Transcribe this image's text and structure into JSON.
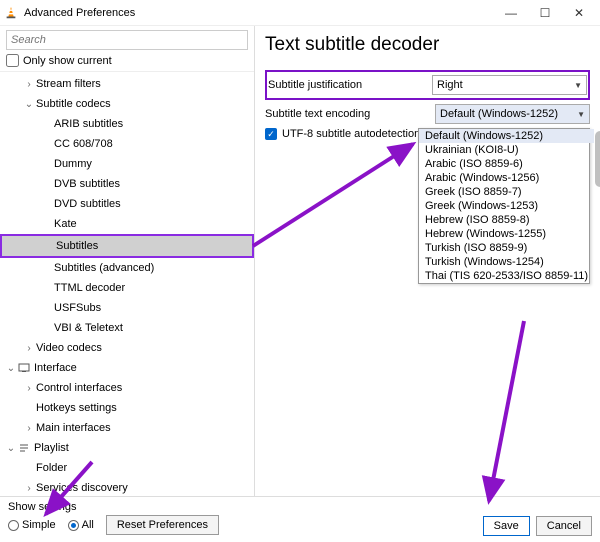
{
  "window": {
    "title": "Advanced Preferences",
    "min": "—",
    "max": "☐",
    "close": "✕"
  },
  "search": {
    "placeholder": "Search"
  },
  "only_current": "Only show current",
  "tree": {
    "stream_filters": "Stream filters",
    "subtitle_codecs": "Subtitle codecs",
    "arib": "ARIB subtitles",
    "cc": "CC 608/708",
    "dummy": "Dummy",
    "dvb": "DVB subtitles",
    "dvd": "DVD subtitles",
    "kate": "Kate",
    "subtitles": "Subtitles",
    "subtitles_adv": "Subtitles (advanced)",
    "ttml": "TTML decoder",
    "usf": "USFSubs",
    "vbi": "VBI & Teletext",
    "video_codecs": "Video codecs",
    "interface": "Interface",
    "control_if": "Control interfaces",
    "hotkeys": "Hotkeys settings",
    "main_if": "Main interfaces",
    "playlist": "Playlist",
    "folder": "Folder",
    "services": "Services discovery"
  },
  "page": {
    "title": "Text subtitle decoder",
    "just_label": "Subtitle justification",
    "just_value": "Right",
    "enc_label": "Subtitle text encoding",
    "enc_value": "Default (Windows-1252)",
    "utf8": "UTF-8 subtitle autodetection"
  },
  "encodings": {
    "e0": "Default (Windows-1252)",
    "e1": "Ukrainian (KOI8-U)",
    "e2": "Arabic (ISO 8859-6)",
    "e3": "Arabic (Windows-1256)",
    "e4": "Greek (ISO 8859-7)",
    "e5": "Greek (Windows-1253)",
    "e6": "Hebrew (ISO 8859-8)",
    "e7": "Hebrew (Windows-1255)",
    "e8": "Turkish (ISO 8859-9)",
    "e9": "Turkish (Windows-1254)",
    "e10": "Thai (TIS 620-2533/ISO 8859-11)"
  },
  "footer": {
    "show": "Show settings",
    "simple": "Simple",
    "all": "All",
    "reset": "Reset Preferences",
    "save": "Save",
    "cancel": "Cancel"
  }
}
